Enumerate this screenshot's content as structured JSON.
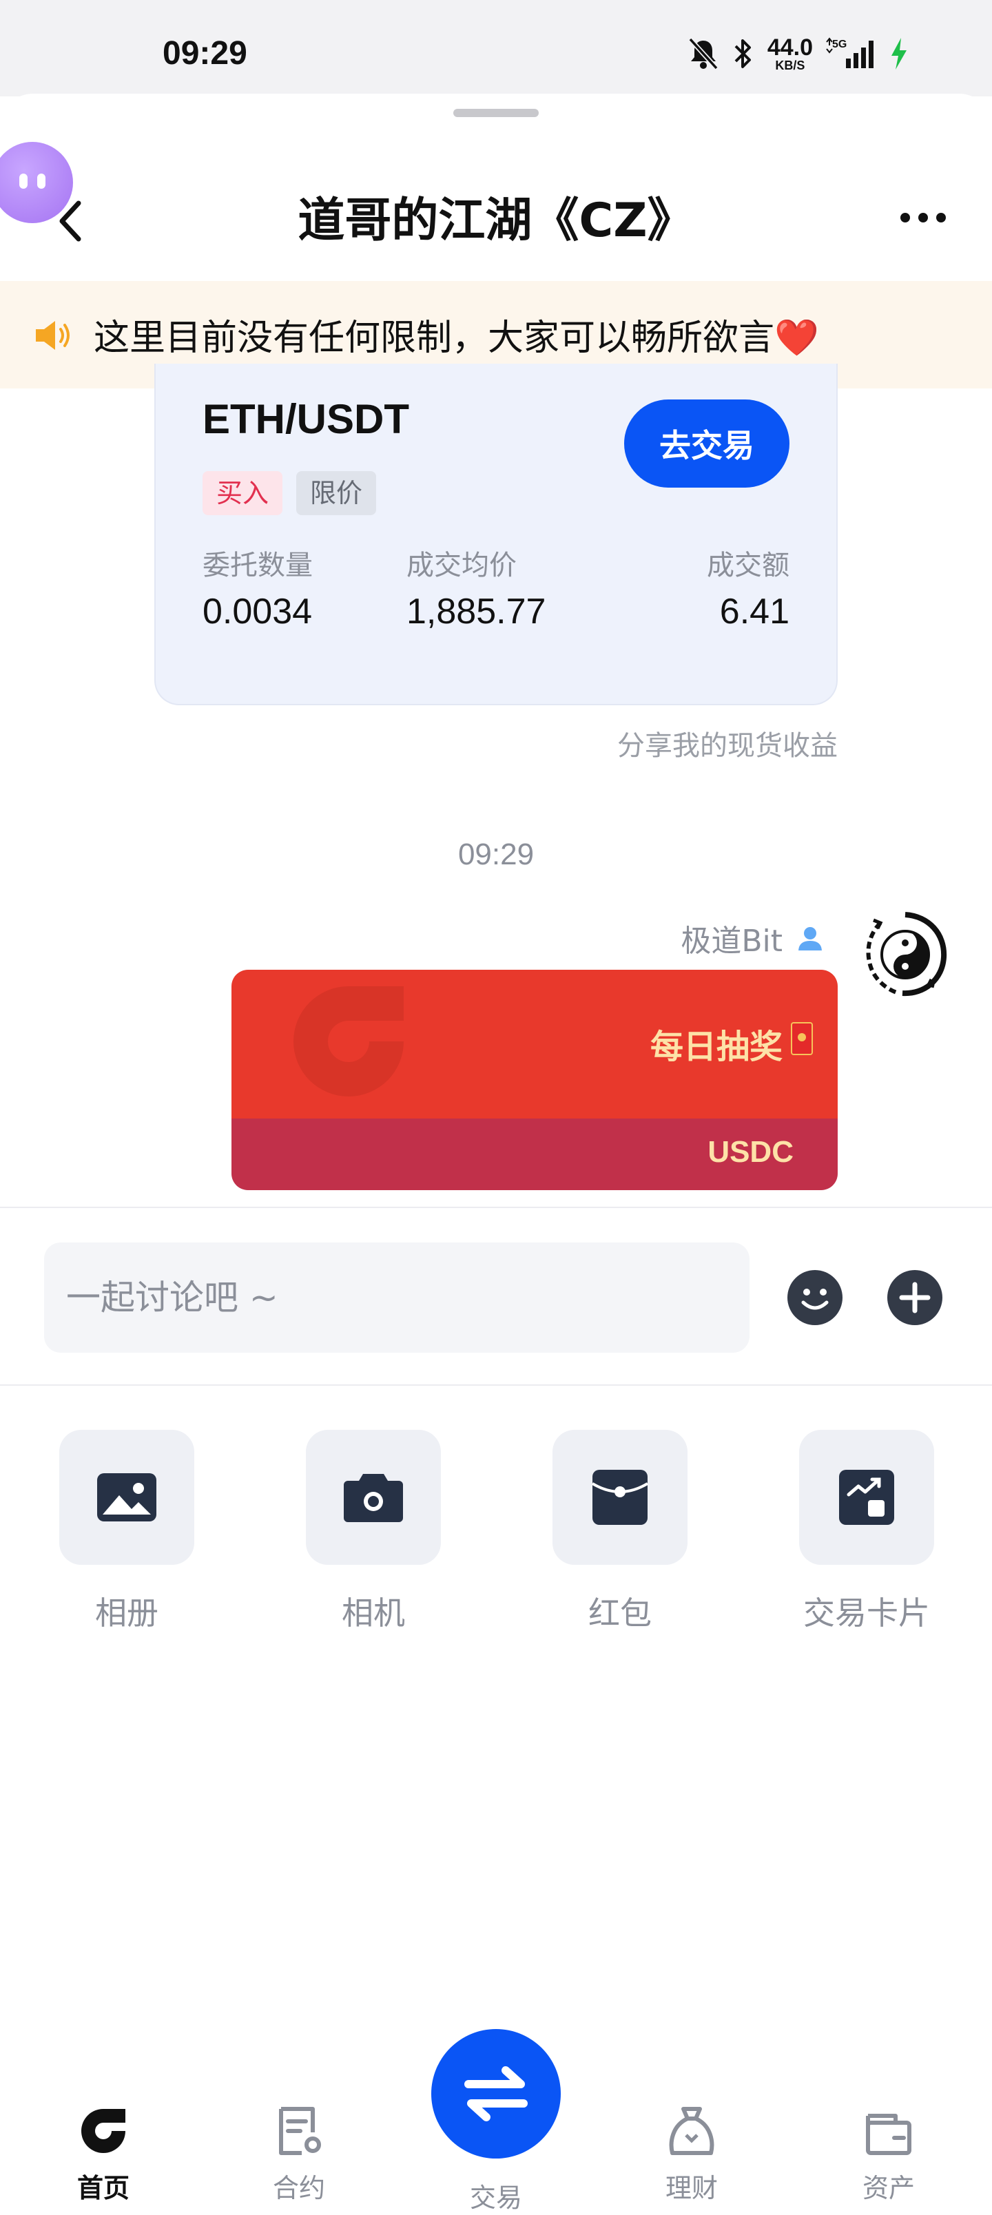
{
  "status_bar": {
    "time": "09:29",
    "net_speed": "44.0",
    "net_unit": "KB/S",
    "network": "5G",
    "icons": [
      "mute-bell-icon",
      "bluetooth-icon",
      "signal-icon",
      "charging-icon"
    ]
  },
  "header": {
    "title": "道哥的江湖《CZ》",
    "back_icon": "chevron-left-icon",
    "more_icon": "more-dots-icon"
  },
  "notice": {
    "text": "这里目前没有任何限制，大家可以畅所欲言❤️",
    "icon": "speaker-icon"
  },
  "trade_card": {
    "pair": "ETH/USDT",
    "side": "买入",
    "order_type": "限价",
    "button": "去交易",
    "stats": [
      {
        "label": "委托数量",
        "value": "0.0034"
      },
      {
        "label": "成交均价",
        "value": "1,885.77"
      },
      {
        "label": "成交额",
        "value": "6.41"
      }
    ],
    "caption": "分享我的现货收益"
  },
  "timestamp": "09:29",
  "message": {
    "sender": "极道Bit",
    "red_packet": {
      "title": "每日抽奖",
      "coin": "USDC"
    }
  },
  "composer": {
    "placeholder": "一起讨论吧 ~"
  },
  "tools": [
    {
      "label": "相册",
      "icon": "photo-icon"
    },
    {
      "label": "相机",
      "icon": "camera-icon"
    },
    {
      "label": "红包",
      "icon": "red-packet-icon"
    },
    {
      "label": "交易卡片",
      "icon": "trade-card-icon"
    }
  ],
  "nav": [
    {
      "label": "首页",
      "icon": "home-logo-icon",
      "active": true
    },
    {
      "label": "合约",
      "icon": "contract-icon"
    },
    {
      "label": "交易",
      "icon": "swap-icon"
    },
    {
      "label": "理财",
      "icon": "finance-icon"
    },
    {
      "label": "资产",
      "icon": "wallet-icon"
    }
  ],
  "colors": {
    "accent": "#0a55f5",
    "buy": "#e2304f",
    "red_packet": "#e8392c",
    "red_packet_footer": "#c1304a",
    "notice_bg": "#fdf6ec"
  }
}
